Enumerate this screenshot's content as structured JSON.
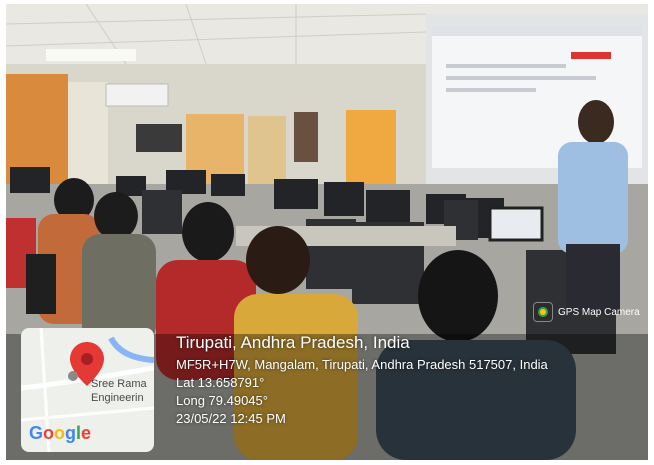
{
  "overlay": {
    "app_badge": "GPS Map Camera",
    "place_title": "Tirupati, Andhra Pradesh, India",
    "address": "MF5R+H7W, Mangalam, Tirupati, Andhra Pradesh 517507, India",
    "latitude": "Lat 13.658791°",
    "longitude": "Long 79.49045°",
    "datetime": "23/05/22 12:45 PM"
  },
  "map": {
    "label_line1": "Sree Rama",
    "label_line2": "Engineerin",
    "provider": {
      "g1": "G",
      "o1": "o",
      "o2": "o",
      "g2": "g",
      "l": "l",
      "e": "e"
    }
  },
  "colors": {
    "pin": "#e53935",
    "screen": "#f4f6f8",
    "wall": "#d9d6cc"
  }
}
